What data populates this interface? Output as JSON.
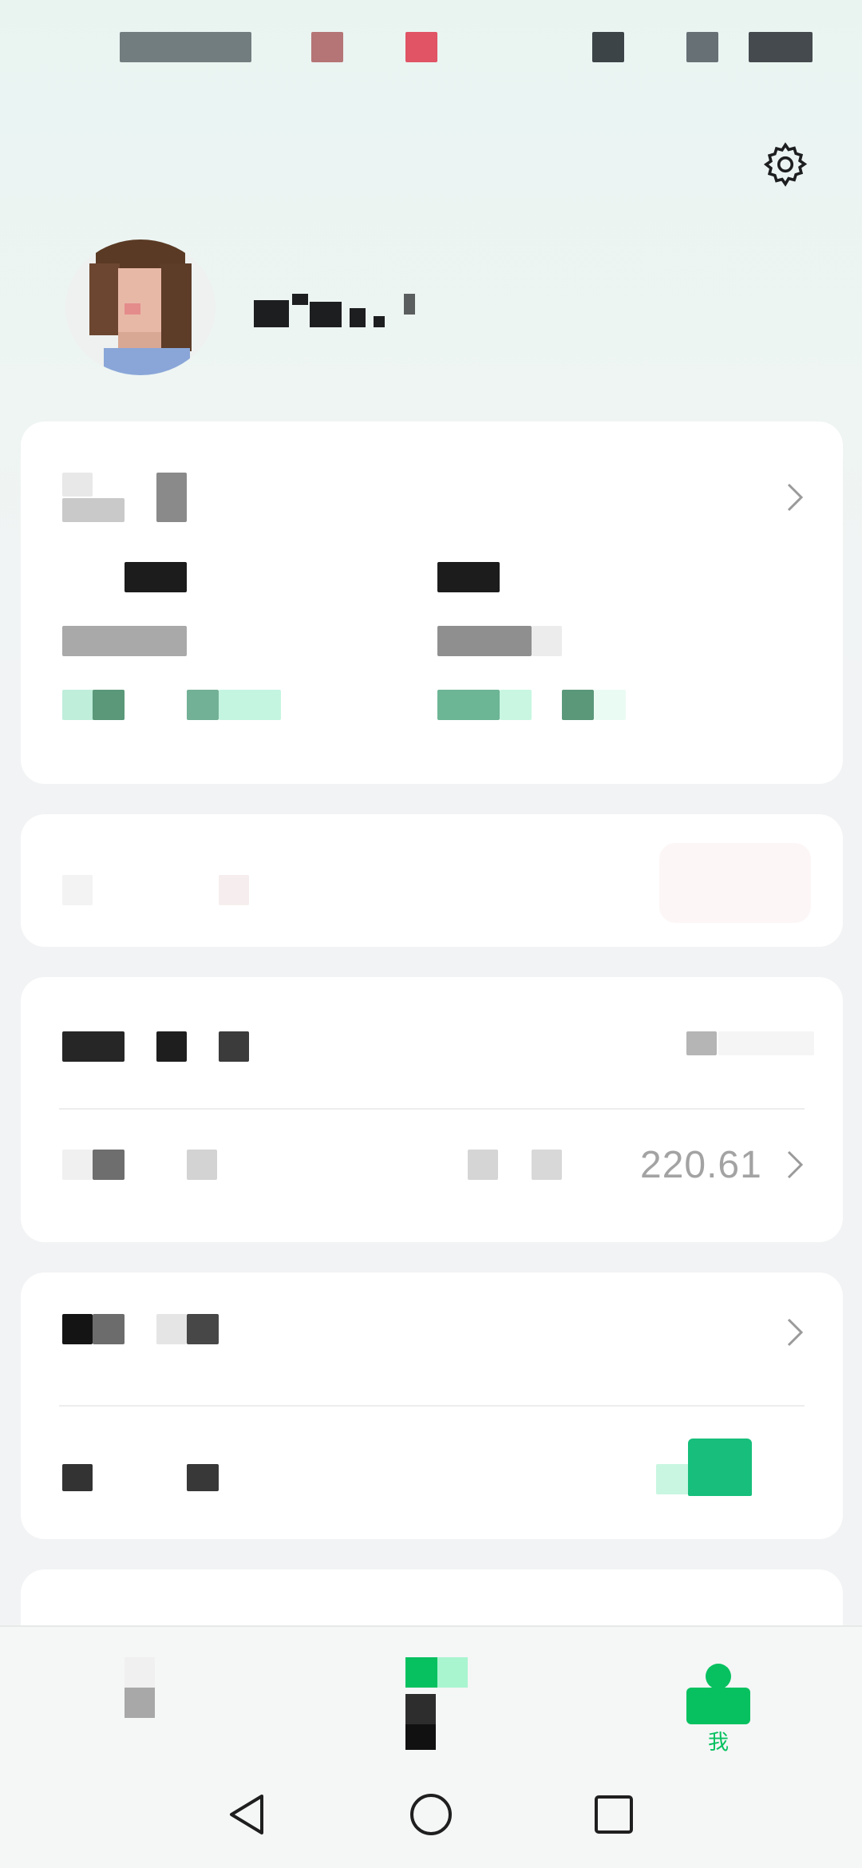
{
  "colors": {
    "accent_green": "#07c160",
    "light_green": "#a9f5d0",
    "text_dark": "#1d1e20",
    "text_gray": "#a3a3a3",
    "card_bg": "#ffffff"
  },
  "header": {
    "settings_icon": "gear-icon",
    "avatar_icon": "avatar"
  },
  "cards": {
    "balance_row": {
      "value": "220.61"
    }
  },
  "bottom_nav": {
    "items": [
      {
        "label": "",
        "active": false
      },
      {
        "label": "",
        "active": false
      },
      {
        "label": "我",
        "active": true
      }
    ]
  },
  "system_nav": {
    "back_icon": "back-triangle-icon",
    "home_icon": "home-circle-icon",
    "recents_icon": "recents-square-icon"
  }
}
